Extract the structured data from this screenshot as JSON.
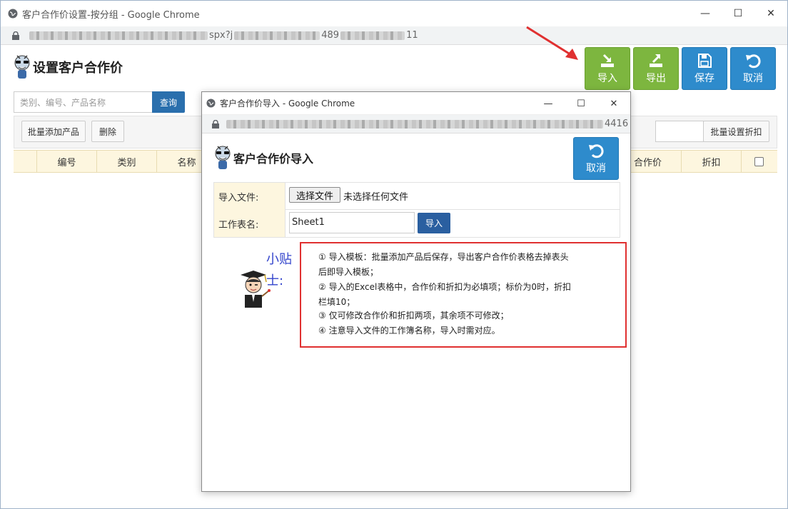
{
  "main_window": {
    "title": "客户合作价设置-按分组 - Google Chrome",
    "url_fragment_1": "spx?j",
    "url_fragment_2": "489",
    "url_fragment_3": "11"
  },
  "page": {
    "title": "设置客户合作价",
    "actions": {
      "import": "导入",
      "export": "导出",
      "save": "保存",
      "cancel": "取消"
    },
    "search": {
      "placeholder": "类别、编号、产品名称",
      "button": "查询"
    },
    "toolbar": {
      "batch_add": "批量添加产品",
      "delete": "删除",
      "batch_discount": "批量设置折扣"
    },
    "table_columns": {
      "code": "编号",
      "category": "类别",
      "name": "名称",
      "coop_price": "合作价",
      "discount": "折扣"
    }
  },
  "popup": {
    "title": "客户合作价导入 - Google Chrome",
    "url_fragment": "4416",
    "header": "客户合作价导入",
    "cancel": "取消",
    "form": {
      "file_label": "导入文件:",
      "file_button": "选择文件",
      "file_status": "未选择任何文件",
      "sheet_label": "工作表名:",
      "sheet_value": "Sheet1",
      "import_button": "导入"
    },
    "tips": {
      "label": "小贴士:",
      "lines": [
        "① 导入模板：批量添加产品后保存，导出客户合作价表格去掉表头",
        "后即导入模板；",
        "② 导入的Excel表格中，合作价和折扣为必填项；标价为0时，折扣",
        "栏填10；",
        "③ 仅可修改合作价和折扣两项，其余项不可修改；",
        "④ 注意导入文件的工作簿名称，导入时需对应。"
      ]
    }
  },
  "colors": {
    "green_button": "#7db63f",
    "blue_button": "#2e8bcc",
    "query_button": "#2a6fad",
    "table_header_bg": "#fdf6df",
    "tips_border": "#e03030",
    "arrow": "#e03030"
  },
  "icons": {
    "window": "globe-icon",
    "secure": "lock-icon",
    "import": "import-icon",
    "export": "export-icon",
    "save": "floppy-icon",
    "cancel": "undo-icon"
  }
}
